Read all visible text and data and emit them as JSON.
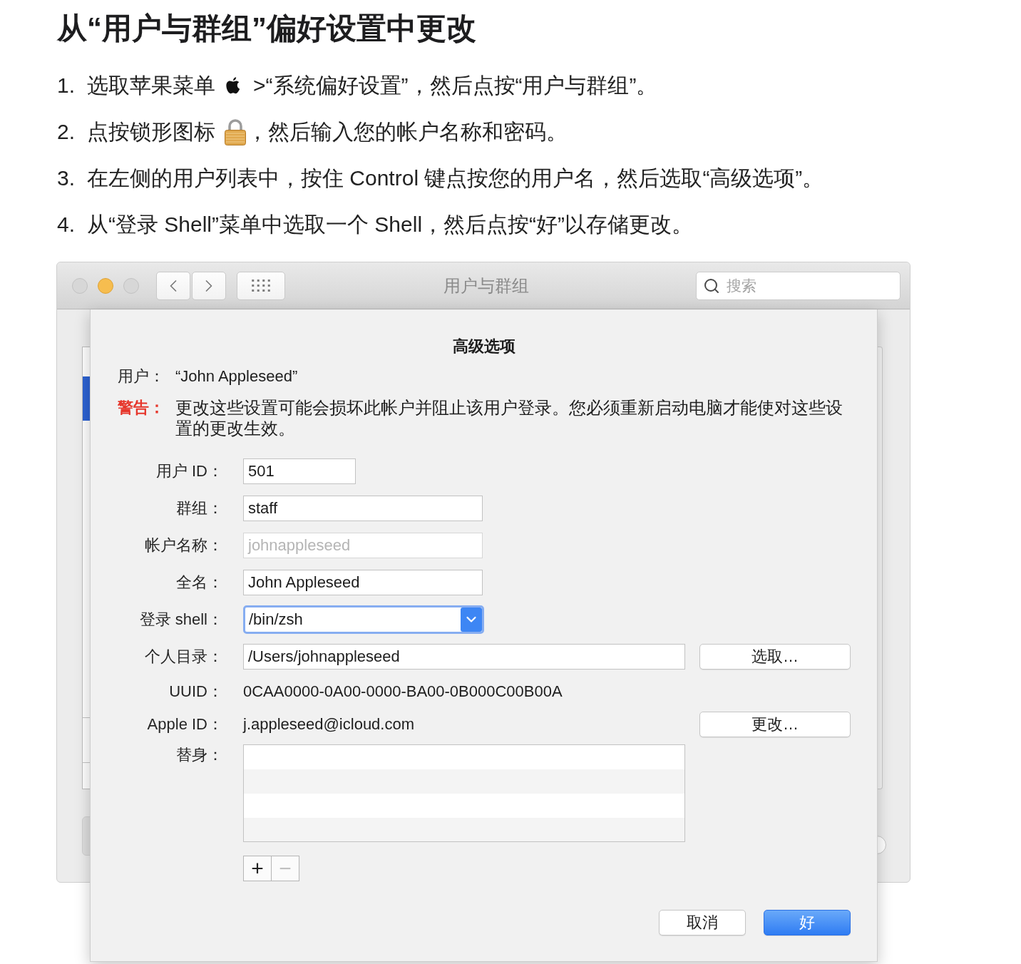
{
  "page_title": "从“用户与群组”偏好设置中更改",
  "steps": [
    {
      "number": "1.",
      "kind": "apple",
      "text": "选取苹果菜单",
      "text_after": ">“系统偏好设置”，然后点按“用户与群组”。"
    },
    {
      "number": "2.",
      "kind": "lock",
      "text": "点按锁形图标",
      "text_after": "，然后输入您的帐户名称和密码。"
    },
    {
      "number": "3.",
      "kind": "plain",
      "text": "在左侧的用户列表中，按住 Control 键点按您的用户名，然后选取“高级选项”。"
    },
    {
      "number": "4.",
      "kind": "plain",
      "text": "从“登录 Shell”菜单中选取一个 Shell，然后点按“好”以存储更改。"
    }
  ],
  "window": {
    "title": "用户与群组",
    "traffic_lights": [
      {
        "kind": "close",
        "enabled": false
      },
      {
        "kind": "minimize",
        "enabled": true
      },
      {
        "kind": "zoom",
        "enabled": false
      }
    ],
    "search": {
      "placeholder": "搜索"
    },
    "user_list": {
      "rows": [
        {
          "selected": false
        },
        {
          "selected": true
        },
        {
          "selected": false
        }
      ]
    }
  },
  "dialog": {
    "title": "高级选项",
    "user": {
      "label": "用户：",
      "value": "“John Appleseed”"
    },
    "warning": {
      "label": "警告：",
      "text": "更改这些设置可能会损坏此帐户并阻止该用户登录。您必须重新启动电脑才能使对这些设置的更改生效。"
    },
    "fields": [
      {
        "kind": "number",
        "label": "用户 ID：",
        "value": "501",
        "disabled": false,
        "focused": false
      },
      {
        "kind": "text",
        "label": "群组：",
        "value": "staff",
        "disabled": false,
        "focused": false
      },
      {
        "kind": "text",
        "label": "帐户名称：",
        "value": "johnappleseed",
        "disabled": true,
        "focused": false
      },
      {
        "kind": "text",
        "label": "全名：",
        "value": "John Appleseed",
        "disabled": false,
        "focused": false
      },
      {
        "kind": "popup",
        "label": "登录 shell：",
        "value": "/bin/zsh",
        "disabled": false,
        "focused": true
      },
      {
        "kind": "wide",
        "label": "个人目录：",
        "value": "/Users/johnappleseed",
        "disabled": false,
        "focused": false,
        "button": "选取…"
      },
      {
        "kind": "static",
        "label": "UUID：",
        "value": "0CAA0000-0A00-0000-BA00-0B000C00B00A",
        "disabled": false,
        "focused": false
      },
      {
        "kind": "static",
        "label": "Apple ID：",
        "value": "j.appleseed@icloud.com",
        "disabled": false,
        "focused": false,
        "button": "更改…"
      },
      {
        "kind": "list",
        "label": "替身：",
        "disabled": false,
        "focused": false
      }
    ],
    "list_buttons": [
      {
        "label": "+",
        "disabled": false
      },
      {
        "label": "−",
        "disabled": true
      }
    ],
    "buttons": [
      {
        "label": "取消",
        "default": false
      },
      {
        "label": "好",
        "default": true
      }
    ]
  }
}
